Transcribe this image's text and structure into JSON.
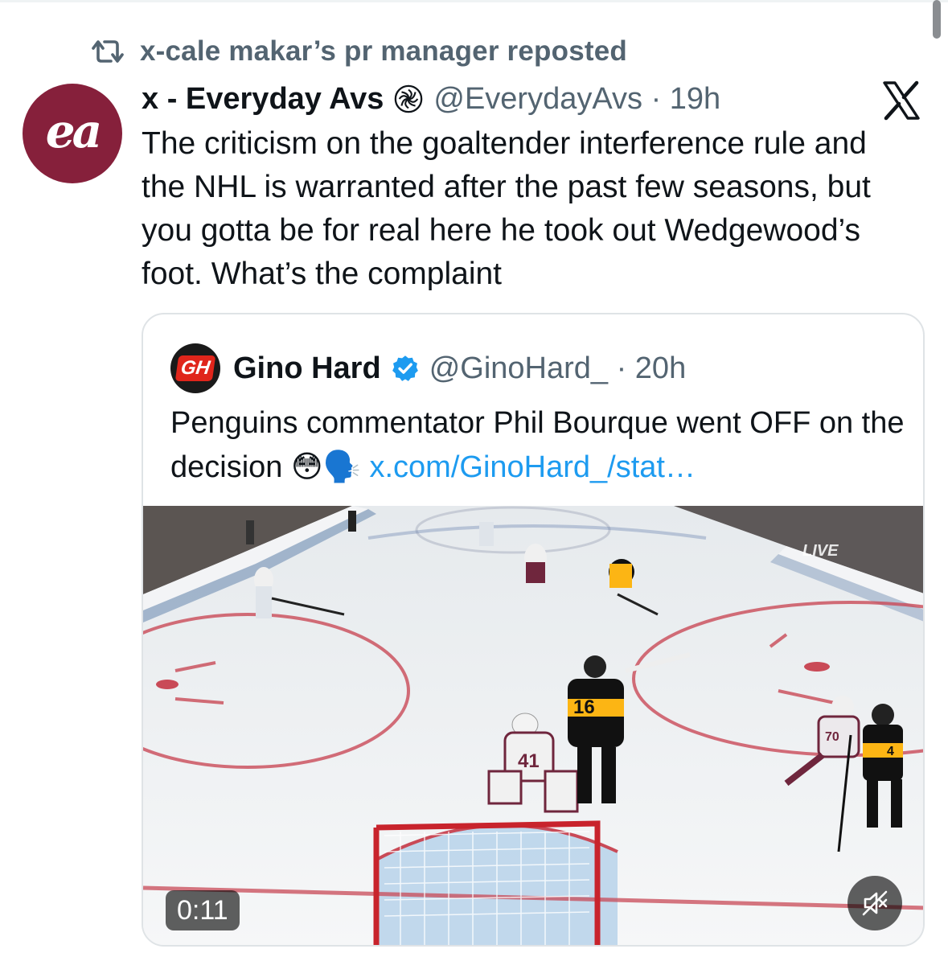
{
  "repost": {
    "label": "x-cale makar’s pr manager reposted"
  },
  "post": {
    "author_name": "x - Everyday Avs",
    "handle_time": "@EverydayAvs · 19h",
    "text": "The criticism on the goaltender interference rule and the NHL is warranted after the past few seasons, but you gotta be for real here he took out Wedgewood’s foot. What’s the complaint",
    "avatar_text": "ea"
  },
  "quote": {
    "author_name": "Gino Hard",
    "handle_time": "@GinoHard_ · 20h",
    "text": "Penguins commentator Phil Bourque went OFF on the decision",
    "emojis": "😳🗣️",
    "link": "x.com/GinoHard_/stat…",
    "avatar_text": "GH"
  },
  "video": {
    "duration": "0:11",
    "overlay_jersey_numbers": [
      "16",
      "41",
      "70",
      "4"
    ],
    "overlay_logo_text": "LIVE"
  },
  "colors": {
    "accent": "#1d9bf0",
    "secondary_text": "#536471",
    "avatar_bg": "#86203b",
    "penguins_gold": "#fcb514",
    "avalanche_burgundy": "#6f263d"
  },
  "icons": {
    "repost": "repost-icon",
    "affiliate_badge": "affiliate-badge-icon",
    "x_logo": "x-logo-icon",
    "verified": "verified-badge-icon",
    "mute": "mute-icon"
  }
}
